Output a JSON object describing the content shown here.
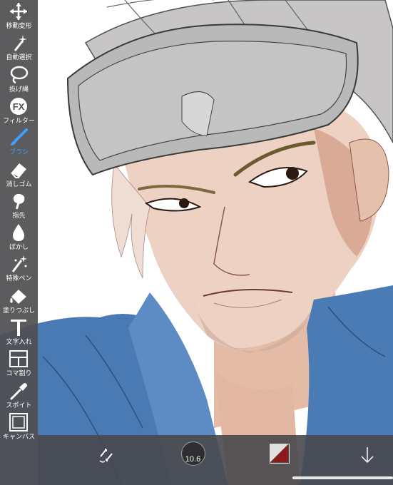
{
  "toolbar": {
    "tools": [
      {
        "name": "move-transform",
        "label": "移動変形",
        "icon": "move-arrows-icon",
        "active": false
      },
      {
        "name": "auto-select",
        "label": "自動選択",
        "icon": "magic-wand-icon",
        "active": false
      },
      {
        "name": "lasso",
        "label": "投げ縄",
        "icon": "lasso-icon",
        "active": false
      },
      {
        "name": "filter",
        "label": "フィルター",
        "icon": "fx-icon",
        "active": false
      },
      {
        "name": "brush",
        "label": "ブラシ",
        "icon": "brush-icon",
        "active": true
      },
      {
        "name": "eraser",
        "label": "消しゴム",
        "icon": "eraser-icon",
        "active": false
      },
      {
        "name": "finger",
        "label": "指先",
        "icon": "smudge-finger-icon",
        "active": false
      },
      {
        "name": "blur",
        "label": "ぼかし",
        "icon": "blur-drop-icon",
        "active": false
      },
      {
        "name": "special-pen",
        "label": "特殊ペン",
        "icon": "sparkle-pen-icon",
        "active": false
      },
      {
        "name": "fill",
        "label": "塗りつぶし",
        "icon": "paint-bucket-icon",
        "active": false
      },
      {
        "name": "text",
        "label": "文字入れ",
        "icon": "text-t-icon",
        "active": false
      },
      {
        "name": "frame-divide",
        "label": "コマ割り",
        "icon": "panel-divide-icon",
        "active": false
      },
      {
        "name": "eyedropper",
        "label": "スポイト",
        "icon": "eyedropper-icon",
        "active": false
      },
      {
        "name": "canvas",
        "label": "キャンバス",
        "icon": "canvas-frame-icon",
        "active": false
      }
    ]
  },
  "bottom_bar": {
    "brush_size": "10.6",
    "icons": [
      "undo-redo-icon",
      "brush-size-icon",
      "color-swatch-icon",
      "download-arrow-icon"
    ]
  },
  "colors": {
    "toolbar_bg": "#505052",
    "active_tool": "#3aa0ff",
    "primary_color": "#8b1a1a",
    "secondary_color": "#ffffff",
    "jacket_blue": "#4a7bb5",
    "skin": "#e9c8b6",
    "hair": "#c8c6c6"
  }
}
